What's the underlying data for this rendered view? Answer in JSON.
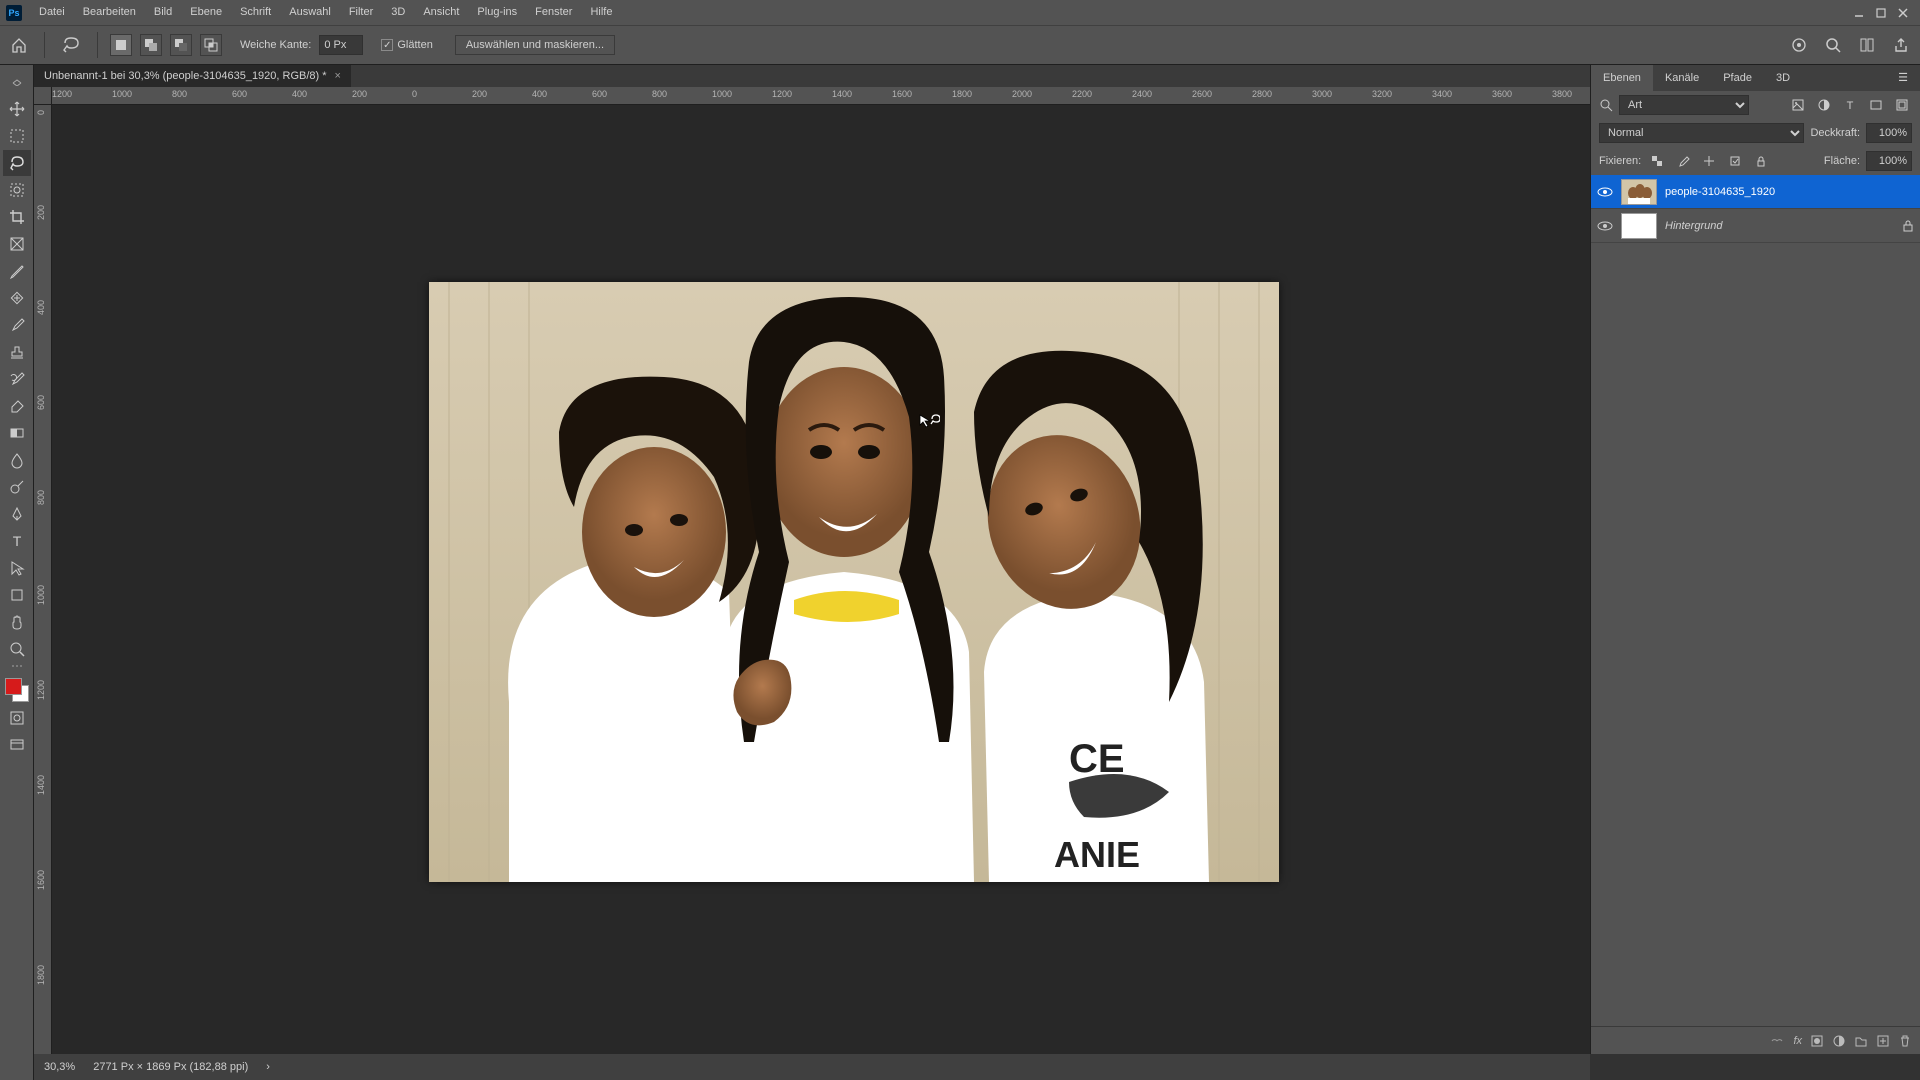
{
  "app_logo": "Ps",
  "menu": [
    "Datei",
    "Bearbeiten",
    "Bild",
    "Ebene",
    "Schrift",
    "Auswahl",
    "Filter",
    "3D",
    "Ansicht",
    "Plug-ins",
    "Fenster",
    "Hilfe"
  ],
  "options": {
    "feather_label": "Weiche Kante:",
    "feather_value": "0 Px",
    "antialias": "Glätten",
    "select_mask": "Auswählen und maskieren..."
  },
  "doc": {
    "title": "Unbenannt-1 bei 30,3% (people-3104635_1920, RGB/8) *"
  },
  "ruler_h": [
    "1200",
    "1000",
    "800",
    "600",
    "400",
    "200",
    "0",
    "200",
    "400",
    "600",
    "800",
    "1000",
    "1200",
    "1400",
    "1600",
    "1800",
    "2000",
    "2200",
    "2400",
    "2600",
    "2800",
    "3000",
    "3200",
    "3400",
    "3600",
    "3800"
  ],
  "ruler_v": [
    "0",
    "200",
    "400",
    "600",
    "800",
    "1000",
    "1200",
    "1400",
    "1600",
    "1800"
  ],
  "panels": {
    "tabs": [
      "Ebenen",
      "Kanäle",
      "Pfade",
      "3D"
    ],
    "filter_label": "Art",
    "blend_mode": "Normal",
    "opacity_label": "Deckkraft:",
    "opacity_value": "100%",
    "lock_label": "Fixieren:",
    "fill_label": "Fläche:",
    "fill_value": "100%"
  },
  "layers": [
    {
      "name": "people-3104635_1920",
      "selected": true,
      "locked": false,
      "bg": false
    },
    {
      "name": "Hintergrund",
      "selected": false,
      "locked": true,
      "bg": true
    }
  ],
  "status": {
    "zoom": "30,3%",
    "info": "2771 Px × 1869 Px (182,88 ppi)"
  }
}
